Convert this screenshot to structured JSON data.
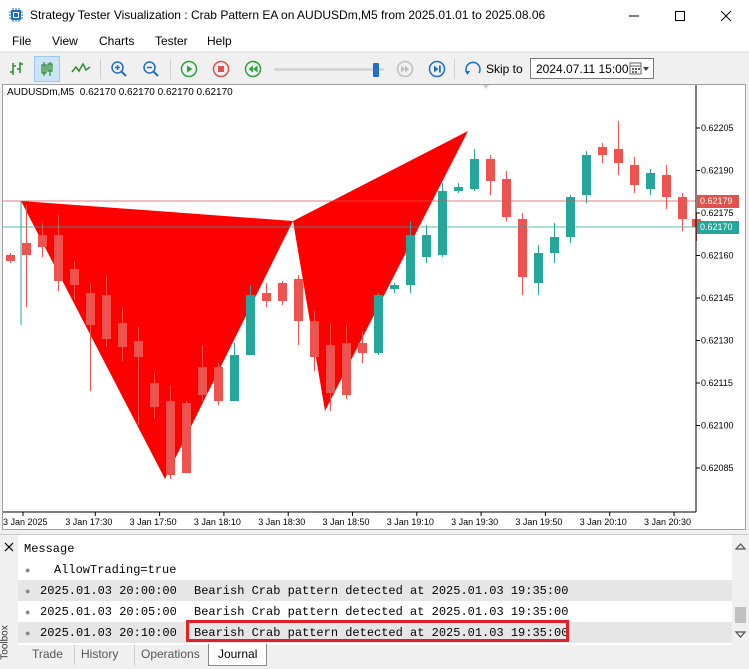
{
  "window": {
    "title": "Strategy Tester Visualization : Crab Pattern EA on AUDUSDm,M5 from 2025.01.01 to 2025.08.06"
  },
  "menu": [
    "File",
    "View",
    "Charts",
    "Tester",
    "Help"
  ],
  "toolbar": {
    "skip_label": "Skip to",
    "skip_value": "2024.07.11 15:00",
    "speed_fraction": 0.95
  },
  "chart": {
    "symbol_line": "AUDUSDm,M5  0.62170 0.62170 0.62170 0.62170",
    "price_labels": [
      "0.62205",
      "0.62190",
      "0.62175",
      "0.62160",
      "0.62145",
      "0.62130",
      "0.62115",
      "0.62100",
      "0.62085"
    ],
    "line_red_label": "0.62179",
    "line_teal_label": "0.62170",
    "time_labels": [
      "3 Jan 2025",
      "3 Jan 17:30",
      "3 Jan 17:50",
      "3 Jan 18:10",
      "3 Jan 18:30",
      "3 Jan 18:50",
      "3 Jan 19:10",
      "3 Jan 19:30",
      "3 Jan 19:50",
      "3 Jan 20:10",
      "3 Jan 20:30"
    ],
    "colors": {
      "bull": "#26a69a",
      "bear": "#ef5350",
      "pattern": "#ff0000",
      "line_red": "#d9534f",
      "line_teal": "#26a69a"
    }
  },
  "journal": {
    "header": "Message",
    "side_label": "Toolbox",
    "rows": [
      {
        "time": "",
        "message": "AllowTrading=true"
      },
      {
        "time": "2025.01.03 20:00:00",
        "message": "Bearish Crab pattern detected at 2025.01.03 19:35:00"
      },
      {
        "time": "2025.01.03 20:05:00",
        "message": "Bearish Crab pattern detected at 2025.01.03 19:35:00"
      },
      {
        "time": "2025.01.03 20:10:00",
        "message": "Bearish Crab pattern detected at 2025.01.03 19:35:00"
      }
    ],
    "tabs": [
      "Trade",
      "History",
      "Operations",
      "Journal"
    ],
    "active_tab": "Journal"
  }
}
